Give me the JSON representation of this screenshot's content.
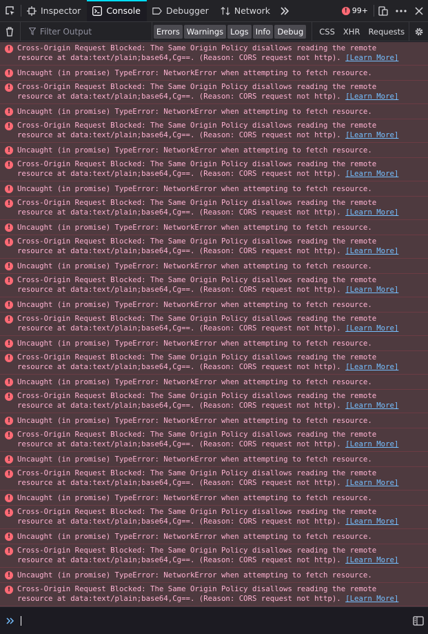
{
  "toolbar": {
    "tabs": [
      {
        "label": "Inspector",
        "icon": "inspector-icon"
      },
      {
        "label": "Console",
        "icon": "console-icon",
        "active": true
      },
      {
        "label": "Debugger",
        "icon": "debugger-icon"
      },
      {
        "label": "Network",
        "icon": "network-icon"
      }
    ],
    "error_count": "99+",
    "error_badge": "!"
  },
  "filterbar": {
    "placeholder": "Filter Output",
    "levels": [
      "Errors",
      "Warnings",
      "Logs",
      "Info",
      "Debug"
    ],
    "requests": [
      "CSS",
      "XHR",
      "Requests"
    ]
  },
  "messages": {
    "cors_line1": "Cross-Origin Request Blocked: The Same Origin Policy disallows reading the remote",
    "cors_line2": "resource at data:text/plain;base64,Cg==. (Reason: CORS request not http). ",
    "learn_more": "[Learn More]",
    "uncaught": "Uncaught (in promise) TypeError: NetworkError when attempting to fetch resource.",
    "pairs": 15
  },
  "colors": {
    "accent": "#00ddff",
    "error_bg": "#4e3a3f",
    "error_text": "#ffb3d2",
    "link": "#75bfff"
  }
}
